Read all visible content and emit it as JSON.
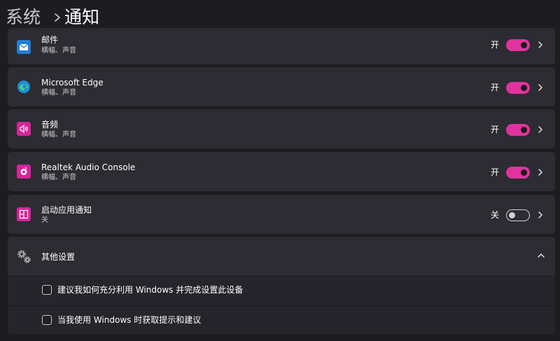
{
  "breadcrumb": {
    "parent": "系统",
    "separator_icon": "chevron-right-icon",
    "current": "通知"
  },
  "apps": [
    {
      "id": "mail",
      "name": "邮件",
      "detail": "横幅、声音",
      "state": "开",
      "enabled": true,
      "icon": "mail-icon",
      "icon_color": "#1f7fd4"
    },
    {
      "id": "edge",
      "name": "Microsoft Edge",
      "detail": "横幅、声音",
      "state": "开",
      "enabled": true,
      "icon": "edge-icon",
      "icon_color": "#2fb3c9"
    },
    {
      "id": "audio",
      "name": "音频",
      "detail": "横幅、声音",
      "state": "开",
      "enabled": true,
      "icon": "speaker-icon",
      "icon_color": "#d6249b"
    },
    {
      "id": "realtek",
      "name": "Realtek Audio Console",
      "detail": "横幅、声音",
      "state": "开",
      "enabled": true,
      "icon": "realtek-icon",
      "icon_color": "#d6249b"
    },
    {
      "id": "startup",
      "name": "启动应用通知",
      "detail": "关",
      "state": "关",
      "enabled": false,
      "icon": "startup-apps-icon",
      "icon_color": "#d6249b"
    }
  ],
  "other_settings": {
    "title": "其他设置",
    "icon": "gears-icon",
    "expanded": true,
    "options": [
      {
        "label": "建议我如何充分利用 Windows 并完成设置此设备",
        "checked": false
      },
      {
        "label": "当我使用 Windows 时获取提示和建议",
        "checked": false
      }
    ]
  },
  "colors": {
    "accent": "#e0339f",
    "background": "#1c1c21",
    "card": "#2c2c32"
  }
}
